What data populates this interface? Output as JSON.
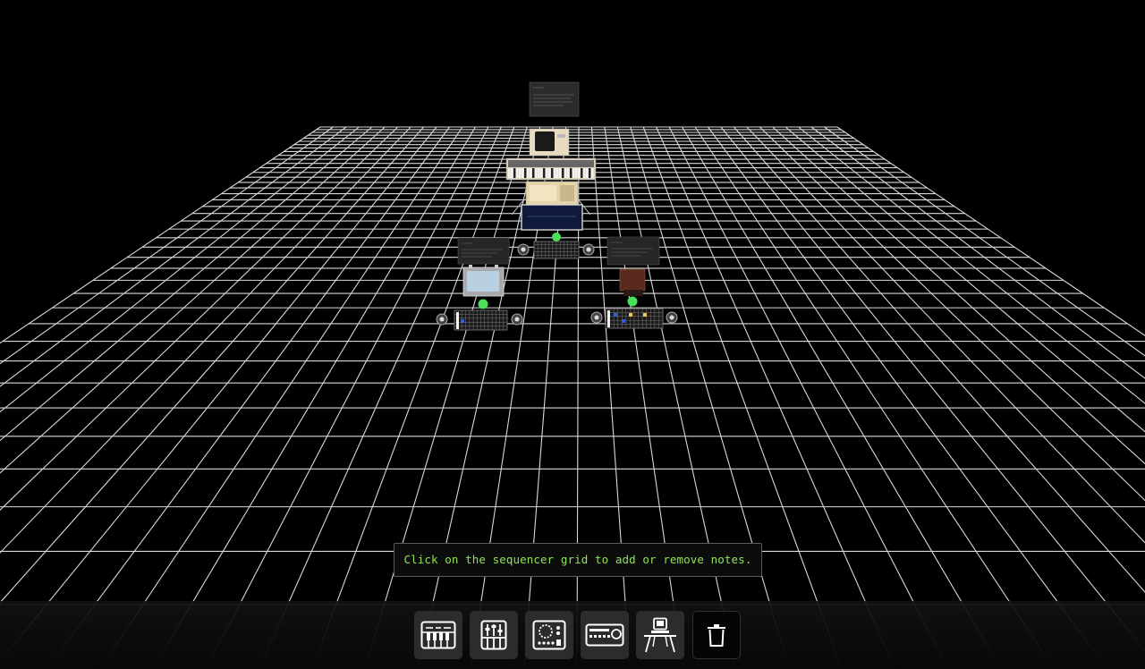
{
  "hint": {
    "text": "Click on the sequencer grid to add or remove notes."
  },
  "toolbar": {
    "buttons": [
      {
        "name": "add-keyboard-button",
        "icon": "piano-keys-icon"
      },
      {
        "name": "add-mixer-button",
        "icon": "mixer-faders-icon"
      },
      {
        "name": "add-synth-module-button",
        "icon": "synth-module-icon"
      },
      {
        "name": "add-rack-unit-button",
        "icon": "rack-unit-icon"
      },
      {
        "name": "add-computer-button",
        "icon": "computer-desk-icon"
      },
      {
        "name": "delete-button",
        "icon": "trash-icon"
      }
    ]
  },
  "colors": {
    "background": "#000000",
    "grid_line": "#d8d8d8",
    "hint_text": "#8fe35a",
    "toolbar_button": "#2c2c2c",
    "indicator_green": "#4be05a"
  }
}
